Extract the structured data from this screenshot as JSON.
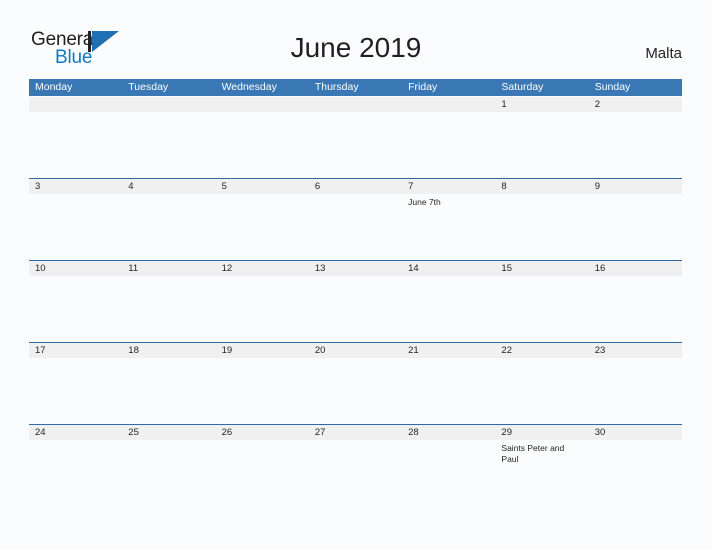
{
  "brand": {
    "word_one": "General",
    "word_two": "Blue",
    "mark_icon": "flag-triangle-icon",
    "accent_color": "#1f6fb2",
    "blue_text_color": "#1278be"
  },
  "header": {
    "title": "June 2019",
    "location": "Malta"
  },
  "calendar": {
    "header_bg": "#3978b5",
    "date_strip_bg": "#f0f0f0",
    "rule_color": "#2e6da4",
    "day_names": [
      "Monday",
      "Tuesday",
      "Wednesday",
      "Thursday",
      "Friday",
      "Saturday",
      "Sunday"
    ],
    "weeks": [
      {
        "days": [
          {
            "date": "",
            "events": []
          },
          {
            "date": "",
            "events": []
          },
          {
            "date": "",
            "events": []
          },
          {
            "date": "",
            "events": []
          },
          {
            "date": "",
            "events": []
          },
          {
            "date": "1",
            "events": []
          },
          {
            "date": "2",
            "events": []
          }
        ]
      },
      {
        "days": [
          {
            "date": "3",
            "events": []
          },
          {
            "date": "4",
            "events": []
          },
          {
            "date": "5",
            "events": []
          },
          {
            "date": "6",
            "events": []
          },
          {
            "date": "7",
            "events": [
              "June 7th"
            ]
          },
          {
            "date": "8",
            "events": []
          },
          {
            "date": "9",
            "events": []
          }
        ]
      },
      {
        "days": [
          {
            "date": "10",
            "events": []
          },
          {
            "date": "11",
            "events": []
          },
          {
            "date": "12",
            "events": []
          },
          {
            "date": "13",
            "events": []
          },
          {
            "date": "14",
            "events": []
          },
          {
            "date": "15",
            "events": []
          },
          {
            "date": "16",
            "events": []
          }
        ]
      },
      {
        "days": [
          {
            "date": "17",
            "events": []
          },
          {
            "date": "18",
            "events": []
          },
          {
            "date": "19",
            "events": []
          },
          {
            "date": "20",
            "events": []
          },
          {
            "date": "21",
            "events": []
          },
          {
            "date": "22",
            "events": []
          },
          {
            "date": "23",
            "events": []
          }
        ]
      },
      {
        "days": [
          {
            "date": "24",
            "events": []
          },
          {
            "date": "25",
            "events": []
          },
          {
            "date": "26",
            "events": []
          },
          {
            "date": "27",
            "events": []
          },
          {
            "date": "28",
            "events": []
          },
          {
            "date": "29",
            "events": [
              "Saints Peter and Paul"
            ]
          },
          {
            "date": "30",
            "events": []
          }
        ]
      }
    ]
  }
}
